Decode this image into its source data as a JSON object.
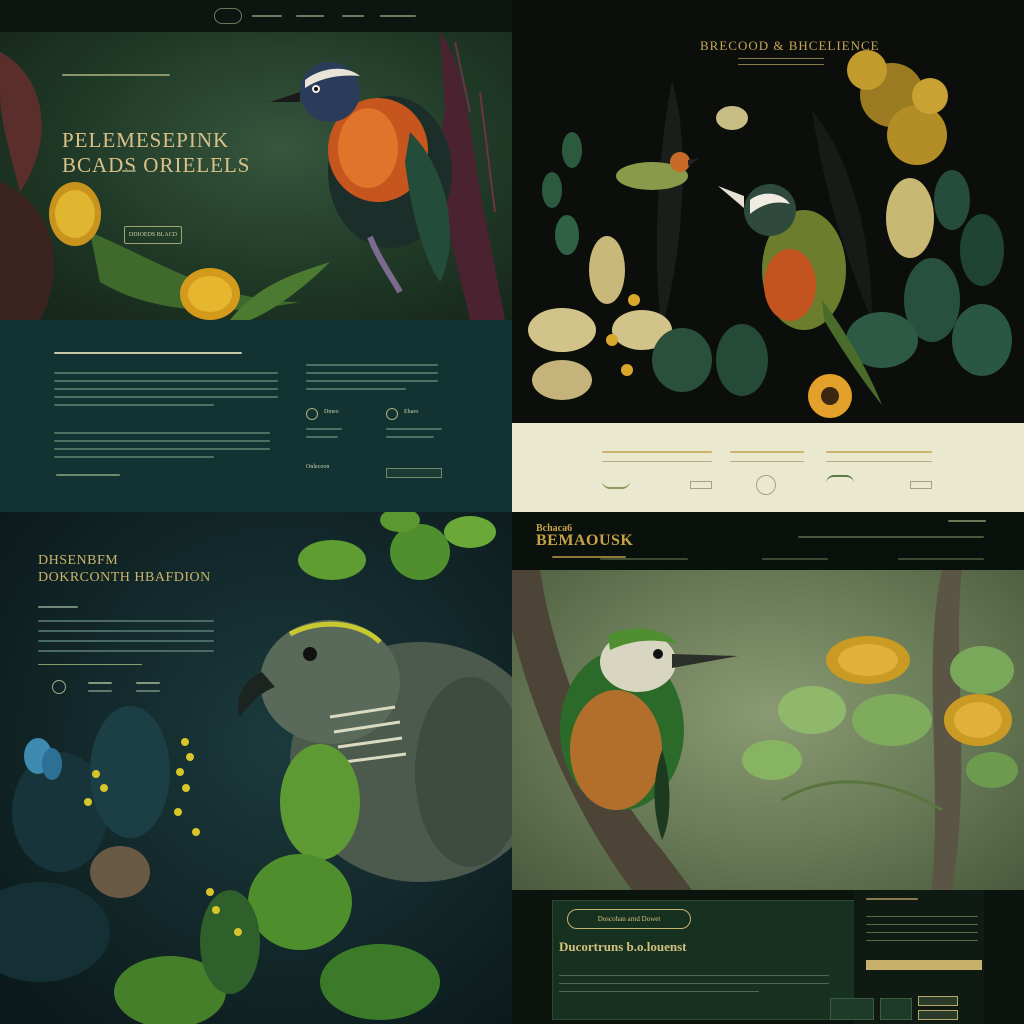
{
  "panels": {
    "tl": {
      "hero_title_line1": "PELEMESEPINK",
      "hero_title_line2": "BCADS ORIELELS",
      "cta_label": "DDIOEDS BLACD",
      "icon_label_1": "Dmeo",
      "icon_label_2": "Ebaro",
      "link_label": "Onlecoon"
    },
    "tr": {
      "brand": "BRECOOD & BHCELIENCE"
    },
    "bl": {
      "title_line1": "DHSENBFM",
      "title_line2": "DOKRCONTH HBAFDION"
    },
    "br": {
      "brand_line1": "Bchaca6",
      "brand_line2": "BEMAOUSK",
      "pill_label": "Doscohan arnd Dowet",
      "card_title": "Ducortruns b.o.louenst"
    }
  },
  "colors": {
    "gold": "#c7a14a",
    "teal_panel": "#133332",
    "cream_footer": "#ebe8d0",
    "forest": "#173121"
  },
  "icons": [
    "bird-illustration",
    "leaf-icon",
    "flower-icon",
    "butterfly-icon",
    "play-icon"
  ]
}
